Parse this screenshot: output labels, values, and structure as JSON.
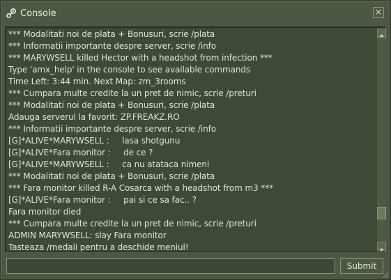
{
  "window": {
    "title": "Console",
    "icon": "steam-icon",
    "close_glyph": "✕"
  },
  "log": {
    "lines": [
      "*** Modalitati noi de plata + Bonusuri, scrie /plata",
      "*** Informatii importante despre server, scrie /info",
      "*** MARYWSELL killed Hector with a headshot from infection ***",
      "Type 'amx_help' in the console to see available commands",
      "Time Left: 3:44 min. Next Map: zm_3rooms",
      "*** Cumpara multe credite la un pret de nimic, scrie /preturi",
      "*** Modalitati noi de plata + Bonusuri, scrie /plata",
      "Adauga serverul la favorit: ZP.FREAKZ.RO",
      "*** Informatii importante despre server, scrie /info",
      "[G]*ALIVE*MARYWSELL :     lasa shotgunu",
      "[G]*ALIVE*Fara monitor :     de ce ?",
      "[G]*ALIVE*MARYWSELL :     ca nu atataca nimeni",
      "*** Modalitati noi de plata + Bonusuri, scrie /plata",
      "*** Fara monitor killed R-A Cosarca with a headshot from m3 ***",
      "[G]*ALIVE*Fara monitor :     pai si ce sa fac.. ?",
      "Fara monitor died",
      "*** Cumpara multe credite la un pret de nimic, scrie /preturi",
      "ADMIN MARYWSELL: slay Fara monitor",
      "Tasteaza /medali pentru a deschide meniul!"
    ]
  },
  "command": {
    "value": "",
    "submit_label": "Submit"
  }
}
